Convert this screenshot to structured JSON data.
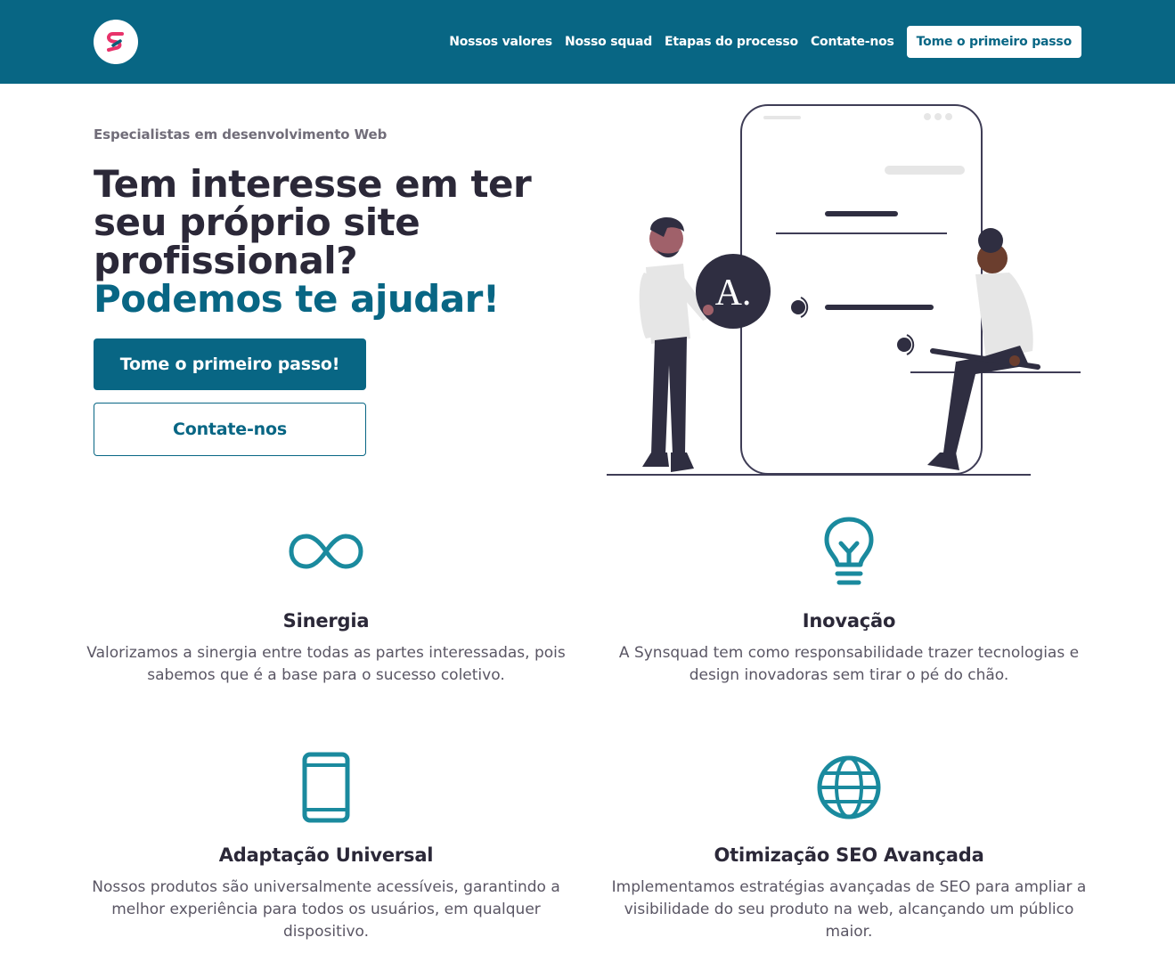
{
  "header": {
    "logo_alt": "S",
    "nav": [
      "Nossos valores",
      "Nosso squad",
      "Etapas do processo",
      "Contate-nos"
    ],
    "cta": "Tome o primeiro passo"
  },
  "hero": {
    "eyebrow": "Especialistas em desenvolvimento Web",
    "title": "Tem interesse em ter seu próprio site profissional?",
    "title_accent": "Podemos te ajudar!",
    "primary_button": "Tome o primeiro passo!",
    "secondary_button": "Contate-nos",
    "illustration_badge": "A."
  },
  "features": [
    {
      "icon": "infinity-icon",
      "title": "Sinergia",
      "text": "Valorizamos a sinergia entre todas as partes interessadas, pois sabemos que é a base para o sucesso coletivo."
    },
    {
      "icon": "lightbulb-icon",
      "title": "Inovação",
      "text": "A Synsquad tem como responsabilidade trazer tecnologias e design inovadoras sem tirar o pé do chão."
    },
    {
      "icon": "smartphone-icon",
      "title": "Adaptação Universal",
      "text": "Nossos produtos são universalmente acessíveis, garantindo a melhor experiência para todos os usuários, em qualquer dispositivo."
    },
    {
      "icon": "globe-icon",
      "title": "Otimização SEO Avançada",
      "text": "Implementamos estratégias avançadas de SEO para ampliar a visibilidade do seu produto na web, alcançando um público maior."
    }
  ],
  "colors": {
    "primary": "#086684",
    "icon": "#1a8a9e",
    "dark_text": "#2b2838",
    "muted_text": "#716d79",
    "logo_pink": "#e8336b"
  }
}
